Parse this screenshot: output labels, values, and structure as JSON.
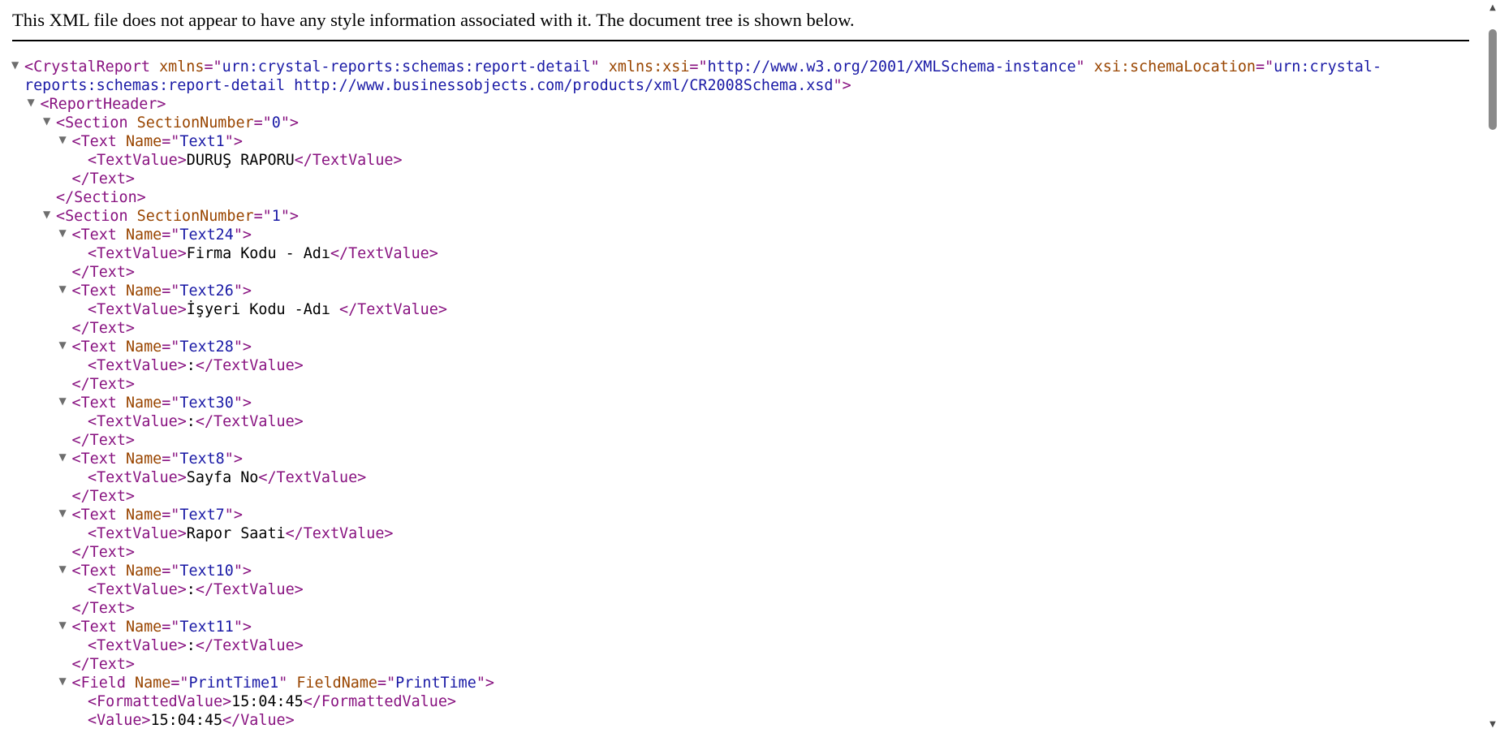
{
  "notice": "This XML file does not appear to have any style information associated with it. The document tree is shown below.",
  "tree_lines": [
    {
      "indent": 0,
      "toggle": true,
      "parts": [
        {
          "t": "<CrystalReport ",
          "c": "tagtext"
        },
        {
          "t": "xmlns",
          "c": "attrname"
        },
        {
          "t": "=\"",
          "c": "tagtext"
        },
        {
          "t": "urn:crystal-reports:schemas:report-detail",
          "c": "attrval"
        },
        {
          "t": "\" ",
          "c": "tagtext"
        },
        {
          "t": "xmlns:xsi",
          "c": "attrname"
        },
        {
          "t": "=\"",
          "c": "tagtext"
        },
        {
          "t": "http://www.w3.org/2001/XMLSchema-instance",
          "c": "attrval"
        },
        {
          "t": "\" ",
          "c": "tagtext"
        },
        {
          "t": "xsi:schemaLocation",
          "c": "attrname"
        },
        {
          "t": "=\"",
          "c": "tagtext"
        },
        {
          "t": "urn:crystal-",
          "c": "attrval"
        }
      ]
    },
    {
      "indent": 0,
      "toggle": false,
      "cont": true,
      "parts": [
        {
          "t": "reports:schemas:report-detail http://www.businessobjects.com/products/xml/CR2008Schema.xsd",
          "c": "attrval"
        },
        {
          "t": "\">",
          "c": "tagtext"
        }
      ]
    },
    {
      "indent": 1,
      "toggle": true,
      "parts": [
        {
          "t": "<ReportHeader>",
          "c": "tagtext"
        }
      ]
    },
    {
      "indent": 2,
      "toggle": true,
      "parts": [
        {
          "t": "<Section ",
          "c": "tagtext"
        },
        {
          "t": "SectionNumber",
          "c": "attrname"
        },
        {
          "t": "=\"",
          "c": "tagtext"
        },
        {
          "t": "0",
          "c": "attrval"
        },
        {
          "t": "\">",
          "c": "tagtext"
        }
      ]
    },
    {
      "indent": 3,
      "toggle": true,
      "parts": [
        {
          "t": "<Text ",
          "c": "tagtext"
        },
        {
          "t": "Name",
          "c": "attrname"
        },
        {
          "t": "=\"",
          "c": "tagtext"
        },
        {
          "t": "Text1",
          "c": "attrval"
        },
        {
          "t": "\">",
          "c": "tagtext"
        }
      ]
    },
    {
      "indent": 4,
      "toggle": false,
      "parts": [
        {
          "t": "<TextValue>",
          "c": "tagtext"
        },
        {
          "t": "DURUŞ RAPORU",
          "c": "txt"
        },
        {
          "t": "</TextValue>",
          "c": "tagtext"
        }
      ]
    },
    {
      "indent": 3,
      "toggle": false,
      "parts": [
        {
          "t": "</Text>",
          "c": "tagtext"
        }
      ]
    },
    {
      "indent": 2,
      "toggle": false,
      "parts": [
        {
          "t": "</Section>",
          "c": "tagtext"
        }
      ]
    },
    {
      "indent": 2,
      "toggle": true,
      "parts": [
        {
          "t": "<Section ",
          "c": "tagtext"
        },
        {
          "t": "SectionNumber",
          "c": "attrname"
        },
        {
          "t": "=\"",
          "c": "tagtext"
        },
        {
          "t": "1",
          "c": "attrval"
        },
        {
          "t": "\">",
          "c": "tagtext"
        }
      ]
    },
    {
      "indent": 3,
      "toggle": true,
      "parts": [
        {
          "t": "<Text ",
          "c": "tagtext"
        },
        {
          "t": "Name",
          "c": "attrname"
        },
        {
          "t": "=\"",
          "c": "tagtext"
        },
        {
          "t": "Text24",
          "c": "attrval"
        },
        {
          "t": "\">",
          "c": "tagtext"
        }
      ]
    },
    {
      "indent": 4,
      "toggle": false,
      "parts": [
        {
          "t": "<TextValue>",
          "c": "tagtext"
        },
        {
          "t": "Firma Kodu - Adı",
          "c": "txt"
        },
        {
          "t": "</TextValue>",
          "c": "tagtext"
        }
      ]
    },
    {
      "indent": 3,
      "toggle": false,
      "parts": [
        {
          "t": "</Text>",
          "c": "tagtext"
        }
      ]
    },
    {
      "indent": 3,
      "toggle": true,
      "parts": [
        {
          "t": "<Text ",
          "c": "tagtext"
        },
        {
          "t": "Name",
          "c": "attrname"
        },
        {
          "t": "=\"",
          "c": "tagtext"
        },
        {
          "t": "Text26",
          "c": "attrval"
        },
        {
          "t": "\">",
          "c": "tagtext"
        }
      ]
    },
    {
      "indent": 4,
      "toggle": false,
      "parts": [
        {
          "t": "<TextValue>",
          "c": "tagtext"
        },
        {
          "t": "İşyeri Kodu -Adı ",
          "c": "txt"
        },
        {
          "t": "</TextValue>",
          "c": "tagtext"
        }
      ]
    },
    {
      "indent": 3,
      "toggle": false,
      "parts": [
        {
          "t": "</Text>",
          "c": "tagtext"
        }
      ]
    },
    {
      "indent": 3,
      "toggle": true,
      "parts": [
        {
          "t": "<Text ",
          "c": "tagtext"
        },
        {
          "t": "Name",
          "c": "attrname"
        },
        {
          "t": "=\"",
          "c": "tagtext"
        },
        {
          "t": "Text28",
          "c": "attrval"
        },
        {
          "t": "\">",
          "c": "tagtext"
        }
      ]
    },
    {
      "indent": 4,
      "toggle": false,
      "parts": [
        {
          "t": "<TextValue>",
          "c": "tagtext"
        },
        {
          "t": ":",
          "c": "txt"
        },
        {
          "t": "</TextValue>",
          "c": "tagtext"
        }
      ]
    },
    {
      "indent": 3,
      "toggle": false,
      "parts": [
        {
          "t": "</Text>",
          "c": "tagtext"
        }
      ]
    },
    {
      "indent": 3,
      "toggle": true,
      "parts": [
        {
          "t": "<Text ",
          "c": "tagtext"
        },
        {
          "t": "Name",
          "c": "attrname"
        },
        {
          "t": "=\"",
          "c": "tagtext"
        },
        {
          "t": "Text30",
          "c": "attrval"
        },
        {
          "t": "\">",
          "c": "tagtext"
        }
      ]
    },
    {
      "indent": 4,
      "toggle": false,
      "parts": [
        {
          "t": "<TextValue>",
          "c": "tagtext"
        },
        {
          "t": ":",
          "c": "txt"
        },
        {
          "t": "</TextValue>",
          "c": "tagtext"
        }
      ]
    },
    {
      "indent": 3,
      "toggle": false,
      "parts": [
        {
          "t": "</Text>",
          "c": "tagtext"
        }
      ]
    },
    {
      "indent": 3,
      "toggle": true,
      "parts": [
        {
          "t": "<Text ",
          "c": "tagtext"
        },
        {
          "t": "Name",
          "c": "attrname"
        },
        {
          "t": "=\"",
          "c": "tagtext"
        },
        {
          "t": "Text8",
          "c": "attrval"
        },
        {
          "t": "\">",
          "c": "tagtext"
        }
      ]
    },
    {
      "indent": 4,
      "toggle": false,
      "parts": [
        {
          "t": "<TextValue>",
          "c": "tagtext"
        },
        {
          "t": "Sayfa No",
          "c": "txt"
        },
        {
          "t": "</TextValue>",
          "c": "tagtext"
        }
      ]
    },
    {
      "indent": 3,
      "toggle": false,
      "parts": [
        {
          "t": "</Text>",
          "c": "tagtext"
        }
      ]
    },
    {
      "indent": 3,
      "toggle": true,
      "parts": [
        {
          "t": "<Text ",
          "c": "tagtext"
        },
        {
          "t": "Name",
          "c": "attrname"
        },
        {
          "t": "=\"",
          "c": "tagtext"
        },
        {
          "t": "Text7",
          "c": "attrval"
        },
        {
          "t": "\">",
          "c": "tagtext"
        }
      ]
    },
    {
      "indent": 4,
      "toggle": false,
      "parts": [
        {
          "t": "<TextValue>",
          "c": "tagtext"
        },
        {
          "t": "Rapor Saati",
          "c": "txt"
        },
        {
          "t": "</TextValue>",
          "c": "tagtext"
        }
      ]
    },
    {
      "indent": 3,
      "toggle": false,
      "parts": [
        {
          "t": "</Text>",
          "c": "tagtext"
        }
      ]
    },
    {
      "indent": 3,
      "toggle": true,
      "parts": [
        {
          "t": "<Text ",
          "c": "tagtext"
        },
        {
          "t": "Name",
          "c": "attrname"
        },
        {
          "t": "=\"",
          "c": "tagtext"
        },
        {
          "t": "Text10",
          "c": "attrval"
        },
        {
          "t": "\">",
          "c": "tagtext"
        }
      ]
    },
    {
      "indent": 4,
      "toggle": false,
      "parts": [
        {
          "t": "<TextValue>",
          "c": "tagtext"
        },
        {
          "t": ":",
          "c": "txt"
        },
        {
          "t": "</TextValue>",
          "c": "tagtext"
        }
      ]
    },
    {
      "indent": 3,
      "toggle": false,
      "parts": [
        {
          "t": "</Text>",
          "c": "tagtext"
        }
      ]
    },
    {
      "indent": 3,
      "toggle": true,
      "parts": [
        {
          "t": "<Text ",
          "c": "tagtext"
        },
        {
          "t": "Name",
          "c": "attrname"
        },
        {
          "t": "=\"",
          "c": "tagtext"
        },
        {
          "t": "Text11",
          "c": "attrval"
        },
        {
          "t": "\">",
          "c": "tagtext"
        }
      ]
    },
    {
      "indent": 4,
      "toggle": false,
      "parts": [
        {
          "t": "<TextValue>",
          "c": "tagtext"
        },
        {
          "t": ":",
          "c": "txt"
        },
        {
          "t": "</TextValue>",
          "c": "tagtext"
        }
      ]
    },
    {
      "indent": 3,
      "toggle": false,
      "parts": [
        {
          "t": "</Text>",
          "c": "tagtext"
        }
      ]
    },
    {
      "indent": 3,
      "toggle": true,
      "parts": [
        {
          "t": "<Field ",
          "c": "tagtext"
        },
        {
          "t": "Name",
          "c": "attrname"
        },
        {
          "t": "=\"",
          "c": "tagtext"
        },
        {
          "t": "PrintTime1",
          "c": "attrval"
        },
        {
          "t": "\" ",
          "c": "tagtext"
        },
        {
          "t": "FieldName",
          "c": "attrname"
        },
        {
          "t": "=\"",
          "c": "tagtext"
        },
        {
          "t": "PrintTime",
          "c": "attrval"
        },
        {
          "t": "\">",
          "c": "tagtext"
        }
      ]
    },
    {
      "indent": 4,
      "toggle": false,
      "parts": [
        {
          "t": "<FormattedValue>",
          "c": "tagtext"
        },
        {
          "t": "15:04:45",
          "c": "txt"
        },
        {
          "t": "</FormattedValue>",
          "c": "tagtext"
        }
      ]
    },
    {
      "indent": 4,
      "toggle": false,
      "parts": [
        {
          "t": "<Value>",
          "c": "tagtext"
        },
        {
          "t": "15:04:45",
          "c": "txt"
        },
        {
          "t": "</Value>",
          "c": "tagtext"
        }
      ]
    }
  ],
  "icons": {
    "expand_toggle": "triangle-down-icon",
    "scroll_up": "scroll-up-arrow-icon",
    "scroll_down": "scroll-down-arrow-icon"
  },
  "colors": {
    "tag": "#881280",
    "attribute_name": "#994500",
    "attribute_value": "#1a1aa6",
    "text": "#000000",
    "toggle": "#6e6e6e",
    "scroll_thumb": "#8a8a8a"
  }
}
